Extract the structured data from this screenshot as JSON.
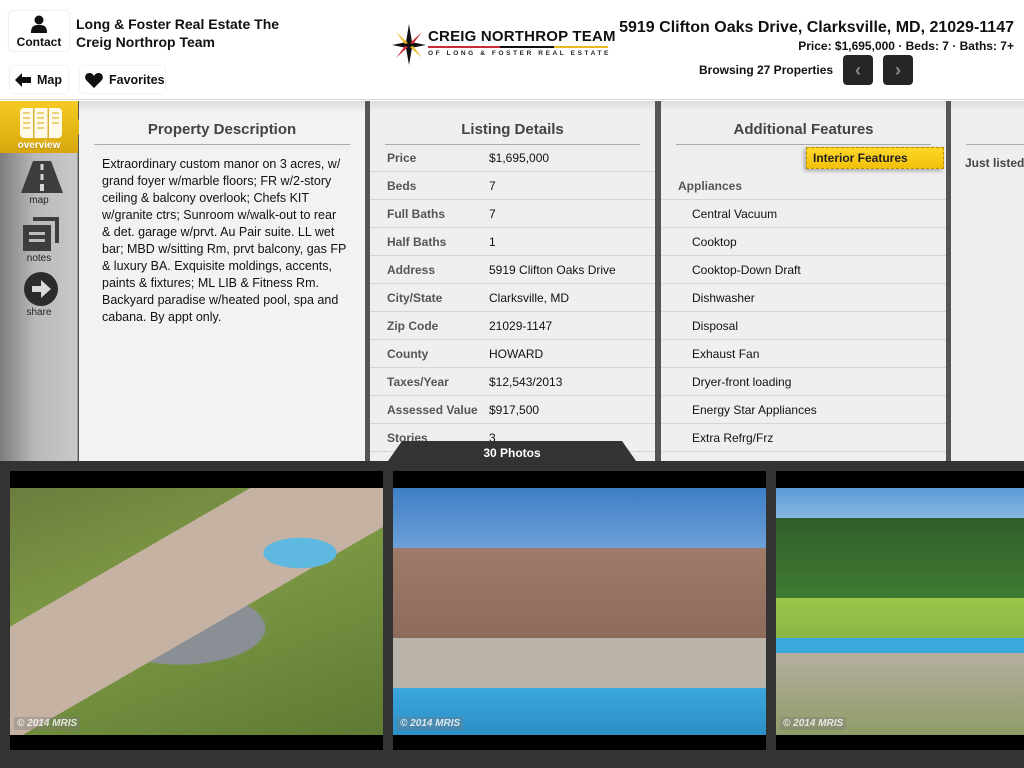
{
  "header": {
    "contact_label": "Contact",
    "brand_name": "Long & Foster Real Estate The Creig Northrop Team",
    "map_label": "Map",
    "favorites_label": "Favorites",
    "logo": {
      "title": "CREIG NORTHROP TEAM",
      "subtitle": "OF LONG & FOSTER REAL ESTATE",
      "colors": {
        "red": "#cc2a36",
        "black": "#111111",
        "yellow": "#e8b923"
      }
    },
    "address": "5919 Clifton Oaks Drive, Clarksville, MD, 21029-1147",
    "summary": "Price: $1,695,000 · Beds: 7 · Baths: 7+",
    "browsing": "Browsing 27 Properties",
    "prev_icon": "chevron-left-icon",
    "next_icon": "chevron-right-icon"
  },
  "sidebar": {
    "accent": "#f2c10b",
    "items": [
      {
        "label": "overview",
        "icon": "overview-columns-icon",
        "active": true
      },
      {
        "label": "map",
        "icon": "road-icon",
        "active": false
      },
      {
        "label": "notes",
        "icon": "notes-icon",
        "active": false
      },
      {
        "label": "share",
        "icon": "share-arrow-icon",
        "active": false
      }
    ]
  },
  "description": {
    "title": "Property Description",
    "text": "Extraordinary custom manor on 3 acres, w/ grand foyer w/marble floors; FR w/2-story ceiling & balcony overlook; Chefs KIT w/granite ctrs; Sunroom w/walk-out to rear & det. garage w/prvt. Au Pair suite. LL wet bar; MBD w/sitting Rm, prvt balcony, gas FP & luxury BA. Exquisite moldings, accents, paints & fixtures; ML LIB & Fitness Rm. Backyard paradise w/heated pool, spa and cabana. By appt only."
  },
  "listing": {
    "title": "Listing Details",
    "rows": [
      {
        "key": "Price",
        "value": "$1,695,000"
      },
      {
        "key": "Beds",
        "value": "7"
      },
      {
        "key": "Full Baths",
        "value": "7"
      },
      {
        "key": "Half Baths",
        "value": "1"
      },
      {
        "key": "Address",
        "value": "5919 Clifton Oaks Drive"
      },
      {
        "key": "City/State",
        "value": "Clarksville, MD"
      },
      {
        "key": "Zip Code",
        "value": "21029-1147"
      },
      {
        "key": "County",
        "value": "HOWARD"
      },
      {
        "key": "Taxes/Year",
        "value": "$12,543/2013"
      },
      {
        "key": "Assessed Value",
        "value": "$917,500"
      },
      {
        "key": "Stories",
        "value": "3"
      }
    ]
  },
  "features": {
    "title": "Additional Features",
    "tag": "Interior Features",
    "group": "Appliances",
    "items": [
      "Central Vacuum",
      "Cooktop",
      "Cooktop-Down Draft",
      "Dishwasher",
      "Disposal",
      "Exhaust Fan",
      "Dryer-front loading",
      "Energy Star Appliances",
      "Extra Refrg/Frz"
    ]
  },
  "extra": {
    "text": "Just listed"
  },
  "photos": {
    "count_label": "30 Photos",
    "items": [
      {
        "alt": "Aerial view of manor and pool",
        "watermark": "© 2014 MRIS"
      },
      {
        "alt": "Rear of house with pool",
        "watermark": "© 2014 MRIS"
      },
      {
        "alt": "Pool and landscaped backyard",
        "watermark": "© 2014 MRIS"
      }
    ]
  }
}
